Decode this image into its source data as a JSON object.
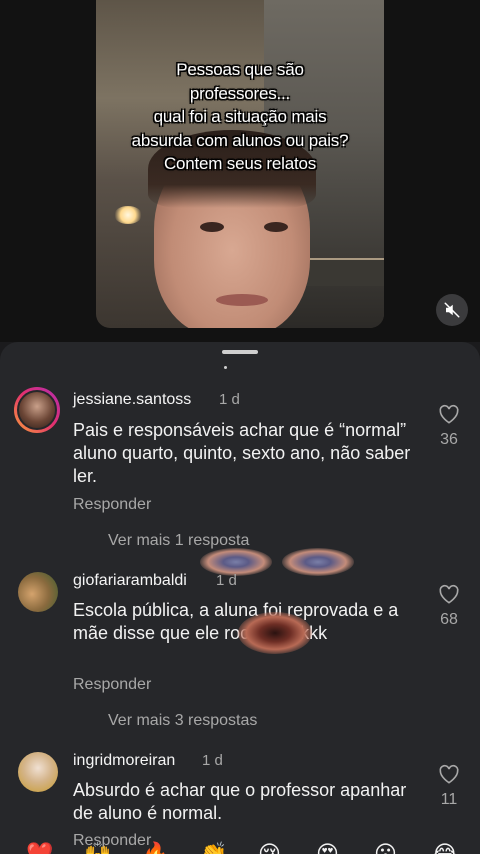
{
  "video": {
    "caption": "Pessoas que são professores... qual foi a situação mais absurda com alunos ou pais? Contem seus relatos",
    "caption_lines": [
      "Pessoas que são",
      "professores...",
      "qual foi a situação mais",
      "absurda com alunos ou pais?",
      "Contem seus relatos"
    ],
    "mute_icon": "speaker-muted-icon"
  },
  "comments": [
    {
      "username": "jessiane.santoss",
      "time": "1 d",
      "text": "Pais e responsáveis achar que é “normal” aluno quarto, quinto, sexto ano, não saber ler.",
      "reply_label": "Responder",
      "likes": "36",
      "more_replies": "Ver mais 1 resposta"
    },
    {
      "username": "giofariarambaldi",
      "time": "1 d",
      "text": "Escola pública, a aluna foi reprovada e a mãe disse que ele rocon. Kkkkk",
      "reply_label": "Responder",
      "likes": "68",
      "more_replies": "Ver mais 3 respostas"
    },
    {
      "username": "ingridmoreiran",
      "time": "1 d",
      "text": "Absurdo é achar que o professor apanhar de aluno é normal.",
      "reply_label": "Responder",
      "likes": "11"
    }
  ],
  "emoji_bar": [
    "❤️",
    "🙌",
    "🔥",
    "👏",
    "😢",
    "😍",
    "😮",
    "😂"
  ],
  "colors": {
    "background": "#1b1b1d",
    "sheet": "#26272a",
    "secondary_text": "#a8a8a8",
    "story_ring": [
      "#f9a13a",
      "#e4316c",
      "#b32cb2"
    ]
  }
}
